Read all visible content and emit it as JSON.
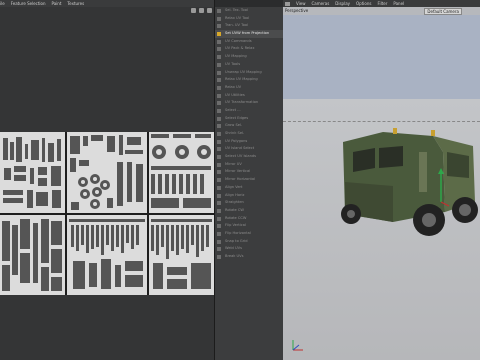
{
  "uv_menu": [
    "ile",
    "Feature Selection",
    "Paint",
    "Textures"
  ],
  "viewport_menu": [
    "View",
    "Cameras",
    "Display",
    "Options",
    "Filter",
    "Panel"
  ],
  "viewport": {
    "label": "Perspective",
    "camera": "Default Camera"
  },
  "tools": [
    {
      "label": "Sel. Tex. Tool",
      "selected": false
    },
    {
      "label": "Relax UV Tool",
      "selected": false
    },
    {
      "label": "Tran. UV Tool",
      "selected": false
    },
    {
      "label": "Set UVW from Projection",
      "selected": true
    },
    {
      "label": "UV Commands",
      "selected": false
    },
    {
      "label": "UV Pack & Relax",
      "selected": false
    },
    {
      "label": "UV Mapping",
      "selected": false
    },
    {
      "label": "UV Tools",
      "selected": false
    },
    {
      "label": "Unwrap UV Mapping",
      "selected": false
    },
    {
      "label": "Relax UV Mapping",
      "selected": false
    },
    {
      "label": "Relax UV",
      "selected": false
    },
    {
      "label": "UV Utilities",
      "selected": false
    },
    {
      "label": "UV Transformation",
      "selected": false
    },
    {
      "label": "Select ...",
      "selected": false
    },
    {
      "label": "Select Edges",
      "selected": false
    },
    {
      "label": "Grow Sel.",
      "selected": false
    },
    {
      "label": "Shrink Sel.",
      "selected": false
    },
    {
      "label": "UV Polygons",
      "selected": false
    },
    {
      "label": "UV Island Select",
      "selected": false
    },
    {
      "label": "Select UV Islands",
      "selected": false
    },
    {
      "label": "Mirror UV",
      "selected": false
    },
    {
      "label": "Mirror Vertical",
      "selected": false
    },
    {
      "label": "Mirror Horizontal",
      "selected": false
    },
    {
      "label": "Align Vert",
      "selected": false
    },
    {
      "label": "Align Horiz",
      "selected": false
    },
    {
      "label": "Straighten",
      "selected": false
    },
    {
      "label": "Rotate CW",
      "selected": false
    },
    {
      "label": "Rotate CCW",
      "selected": false
    },
    {
      "label": "Flip Vertical",
      "selected": false
    },
    {
      "label": "Flip Horizontal",
      "selected": false
    },
    {
      "label": "Snap to Grid",
      "selected": false
    },
    {
      "label": "Weld UVs",
      "selected": false
    },
    {
      "label": "Break UVs",
      "selected": false
    }
  ],
  "colors": {
    "accent": "#d8a82a",
    "panel": "#343536",
    "viewport_bg": "#b0b2b6"
  }
}
